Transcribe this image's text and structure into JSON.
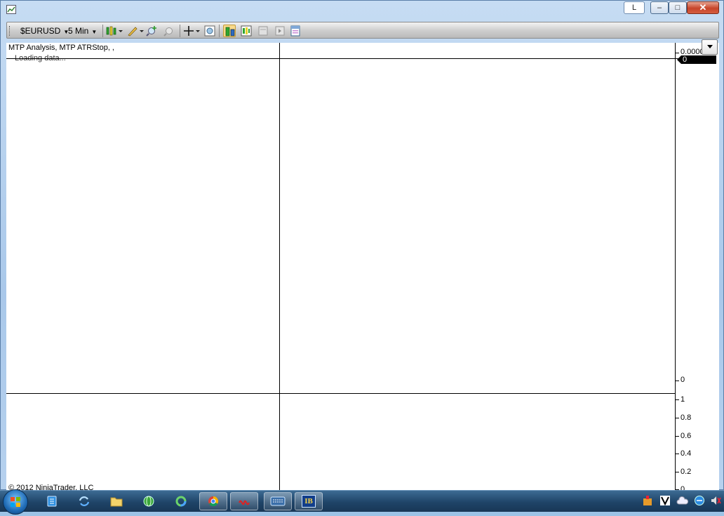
{
  "window": {
    "link_button_label": "L",
    "minimize_glyph": "–",
    "maximize_glyph": "□",
    "close_glyph": "✕"
  },
  "toolbar": {
    "instrument": "$EURUSD",
    "interval": "5 Min",
    "icons": [
      "bar-type-icon",
      "drawing-tool-icon",
      "zoom-in-icon",
      "zoom-out-icon",
      "crosshair-icon",
      "data-box-icon",
      "chart-trader-icon",
      "indicators-icon",
      "strategies-icon",
      "properties-icon",
      "print-icon"
    ]
  },
  "chart": {
    "indicators_label": "MTP Analysis, MTP ATRStop,  ,",
    "status_text": "Loading data...",
    "price_tag": "0",
    "top_panel_axis": [
      "0.0000",
      "0"
    ],
    "bottom_panel_axis": [
      "1",
      "0.8",
      "0.6",
      "0.4",
      "0.2",
      "0"
    ],
    "copyright": "© 2012 NinjaTrader, LLC"
  },
  "taskbar": {
    "apps": [
      "start-button",
      "notepad-icon",
      "sync-app-icon",
      "file-explorer-icon",
      "green-globe-icon",
      "ring-app-icon",
      "chrome-icon",
      "ninjatrader-icon",
      "keyboard-icon",
      "ib-icon"
    ],
    "ib_label": "IB"
  },
  "colors": {
    "chart_bg": "#ffffff",
    "grid": "#000000",
    "taskbar": "#1f4468",
    "close_button": "#c7452a"
  }
}
